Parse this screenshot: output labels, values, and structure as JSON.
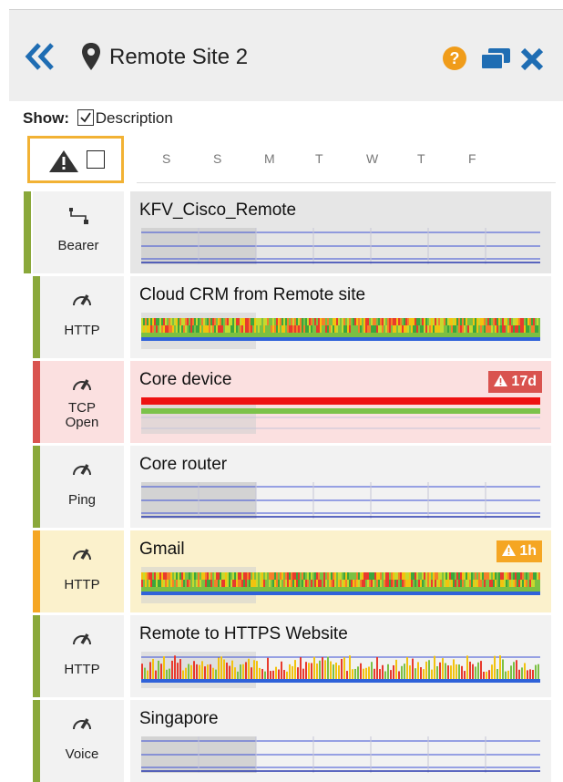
{
  "header": {
    "title": "Remote Site 2",
    "accent": "#1f6db3",
    "help_color": "#f09c1a",
    "icons": [
      "double-chevron-left-icon",
      "map-pin-icon",
      "help-icon",
      "windows-icon",
      "close-icon"
    ]
  },
  "show": {
    "label": "Show:",
    "description_label": "Description",
    "description_checked": true
  },
  "filter": {
    "icons": [
      "warning-icon",
      "checkbox-icon"
    ],
    "checked": false
  },
  "days": [
    "S",
    "S",
    "M",
    "T",
    "W",
    "T",
    "F"
  ],
  "colors": {
    "ok": "#8aa83a",
    "critical": "#d9534f",
    "warning": "#f5a623",
    "critical_bg": "#fbe0e0",
    "warning_bg": "#fbf1cc"
  },
  "monitors": [
    {
      "name": "KFV_Cisco_Remote",
      "type_label": [
        "Bearer"
      ],
      "icon": "bearer-icon",
      "status": "ok",
      "badge": null,
      "graph": "line"
    },
    {
      "name": "Cloud CRM from Remote site",
      "type_label": [
        "HTTP"
      ],
      "icon": "gauge-icon",
      "status": "ok",
      "badge": null,
      "graph": "heat"
    },
    {
      "name": "Core device",
      "type_label": [
        "TCP",
        "Open"
      ],
      "icon": "gauge-icon",
      "status": "critical",
      "badge": "17d",
      "graph": "redgreen"
    },
    {
      "name": "Core router",
      "type_label": [
        "Ping"
      ],
      "icon": "gauge-icon",
      "status": "ok",
      "badge": null,
      "graph": "line"
    },
    {
      "name": "Gmail",
      "type_label": [
        "HTTP"
      ],
      "icon": "gauge-icon",
      "status": "warning",
      "badge": "1h",
      "graph": "heat"
    },
    {
      "name": "Remote to HTTPS Website",
      "type_label": [
        "HTTP"
      ],
      "icon": "gauge-icon",
      "status": "ok",
      "badge": null,
      "graph": "spiky"
    },
    {
      "name": "Singapore",
      "type_label": [
        "Voice"
      ],
      "icon": "gauge-icon",
      "status": "ok",
      "badge": null,
      "graph": "line"
    }
  ]
}
